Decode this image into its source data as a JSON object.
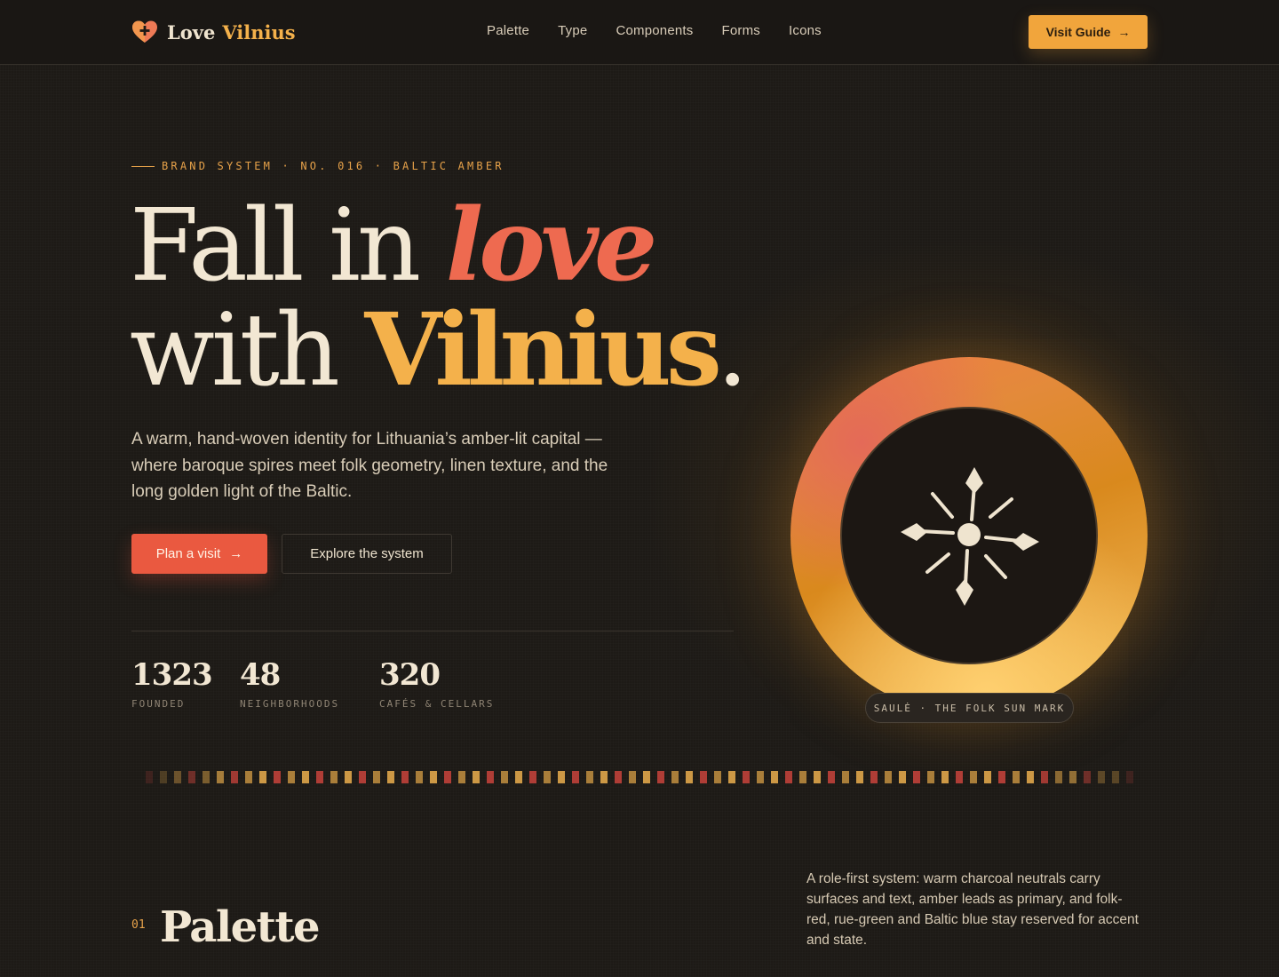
{
  "header": {
    "brand_love": "Love",
    "brand_vilnius": "Vilnius",
    "nav": [
      "Palette",
      "Type",
      "Components",
      "Forms",
      "Icons"
    ],
    "cta_label": "Visit Guide",
    "cta_arrow": "→"
  },
  "hero": {
    "eyebrow": "BRAND SYSTEM · NO. 016 · BALTIC AMBER",
    "headline_part1": "Fall in ",
    "headline_love": "love",
    "headline_part2": "with ",
    "headline_vilnius": "Vilnius",
    "headline_period": ".",
    "subtext": "A warm, hand-woven identity for Lithuania’s amber-lit capital — where baroque spires meet folk geometry, linen texture, and the long golden light of the Baltic.",
    "primary_button": "Plan a visit",
    "primary_arrow": "→",
    "secondary_button": "Explore the system",
    "stats": [
      {
        "value": "1323",
        "label": "FOUNDED"
      },
      {
        "value": "48",
        "label": "NEIGHBORHOODS"
      },
      {
        "value": "320",
        "label": "CAFÉS & CELLARS"
      }
    ],
    "sun_caption": "SAULĖ · THE FOLK SUN MARK"
  },
  "palette_section": {
    "number": "01",
    "title": "Palette",
    "description": "A role-first system: warm charcoal neutrals carry surfaces and text, amber leads as primary, and folk-red, rue-green and Baltic blue stay reserved for accent and state."
  },
  "colors": {
    "background": "#1d1a16",
    "amber": "#f4b14b",
    "folk_red": "#ea5940",
    "text": "#f2e7d3"
  },
  "icons": {
    "brand": "heart-plus-icon",
    "sun": "folk-sun-icon",
    "arrow": "arrow-right-icon"
  }
}
